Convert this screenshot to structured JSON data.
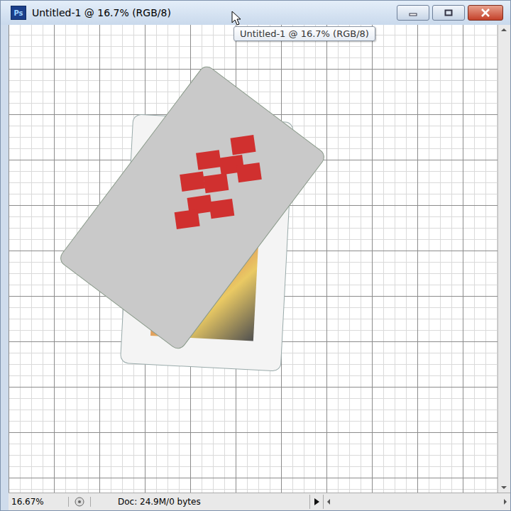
{
  "window": {
    "title": "Untitled-1 @ 16.7% (RGB/8)",
    "app_logo": "Ps"
  },
  "tooltip": {
    "text": "Untitled-1 @ 16.7% (RGB/8)"
  },
  "status_bar": {
    "zoom": "16.67%",
    "doc_info": "Doc: 24.9M/0 bytes"
  }
}
